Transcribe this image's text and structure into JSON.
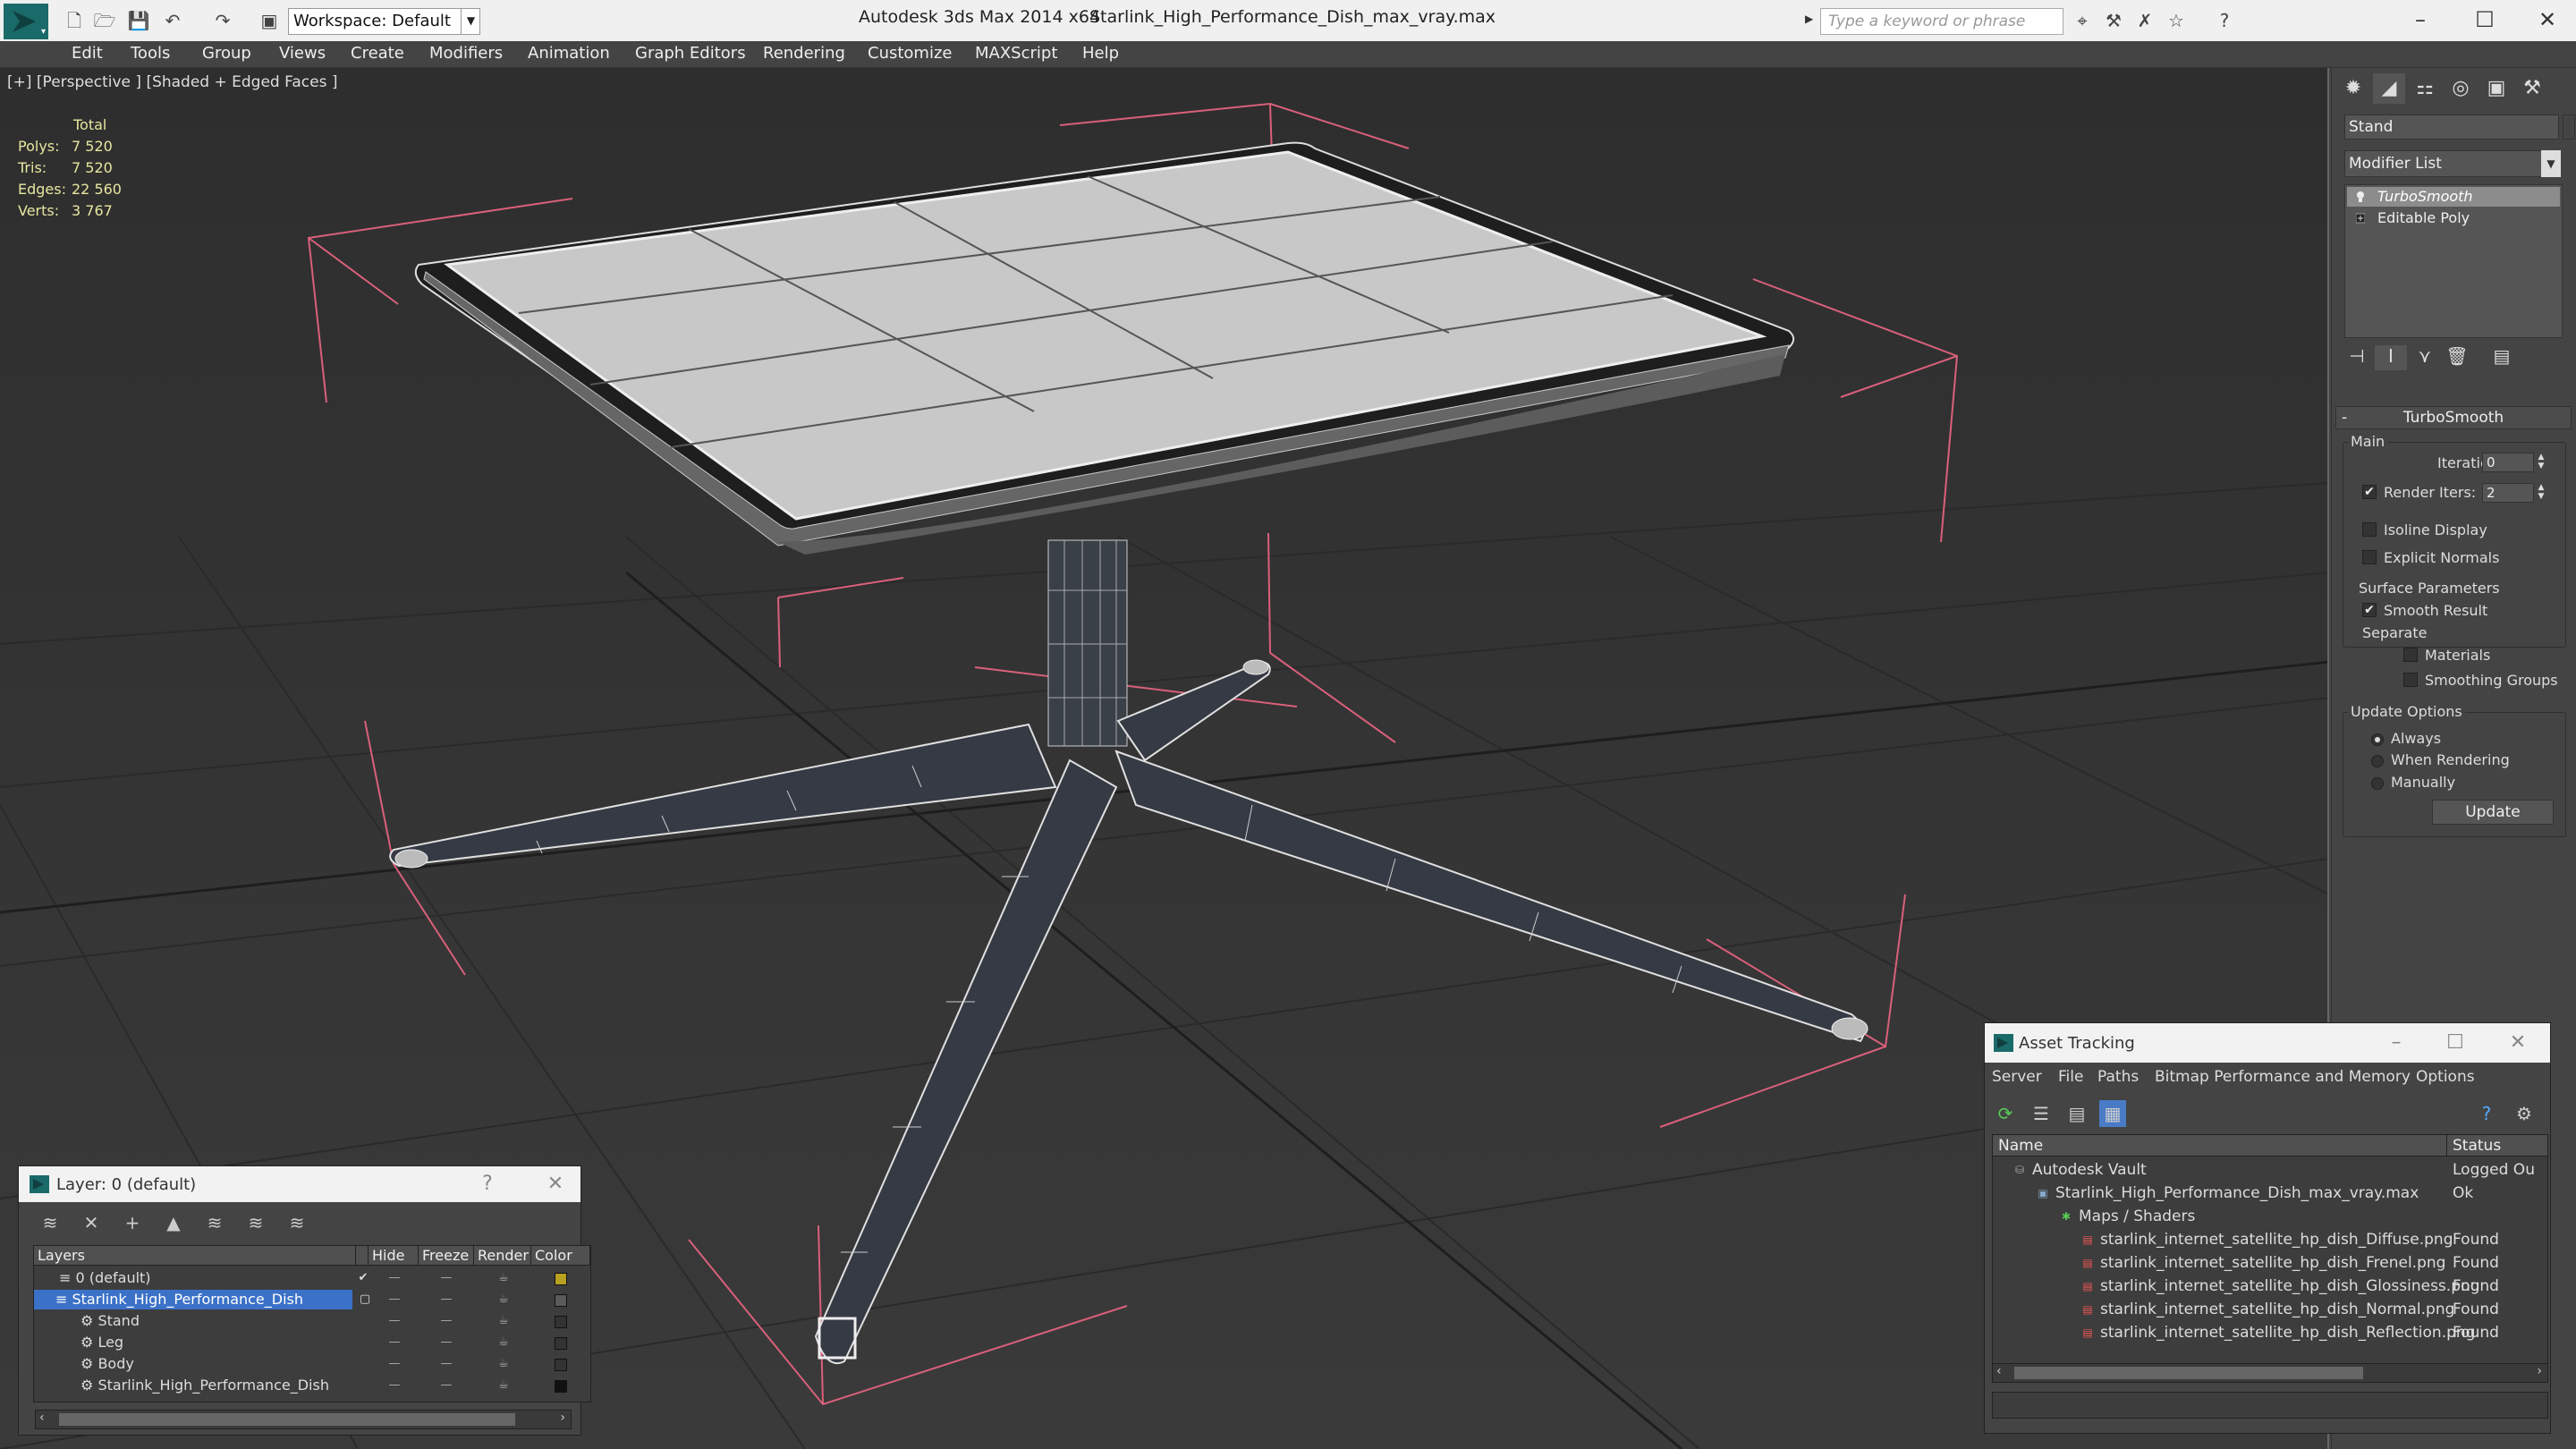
{
  "titlebar": {
    "workspace": "Workspace: Default",
    "app_title": "Autodesk 3ds Max  2014 x64",
    "file_title": "Starlink_High_Performance_Dish_max_vray.max",
    "search_placeholder": "Type a keyword or phrase"
  },
  "menu": [
    "Edit",
    "Tools",
    "Group",
    "Views",
    "Create",
    "Modifiers",
    "Animation",
    "Graph Editors",
    "Rendering",
    "Customize",
    "MAXScript",
    "Help"
  ],
  "viewport": {
    "label": "[+] [Perspective ] [Shaded + Edged Faces ]",
    "stats": {
      "header": "Total",
      "polys_label": "Polys:",
      "polys": "7 520",
      "tris_label": "Tris:",
      "tris": "7 520",
      "edges_label": "Edges:",
      "edges": "22 560",
      "verts_label": "Verts:",
      "verts": "3 767"
    }
  },
  "command_panel": {
    "object_name": "Stand",
    "modifier_list": "Modifier List",
    "stack": [
      "TurboSmooth",
      "Editable Poly"
    ],
    "rollout": "TurboSmooth",
    "main_group": "Main",
    "iterations_label": "Iterations:",
    "iterations": "0",
    "render_iters_label": "Render Iters:",
    "render_iters": "2",
    "isoline": "Isoline Display",
    "explicit_normals": "Explicit Normals",
    "surface_group": "Surface Parameters",
    "smooth_result": "Smooth Result",
    "separate": "Separate",
    "materials": "Materials",
    "smoothing_groups": "Smoothing Groups",
    "update_group": "Update Options",
    "always": "Always",
    "when_rendering": "When Rendering",
    "manually": "Manually",
    "update_button": "Update",
    "colors": {
      "accent": "#3b71c7"
    }
  },
  "layer_window": {
    "title": "Layer: 0 (default)",
    "columns": [
      "Layers",
      "Hide",
      "Freeze",
      "Render",
      "Color"
    ],
    "rows": [
      {
        "name": "0 (default)",
        "color": "#b8a020"
      },
      {
        "name": "Starlink_High_Performance_Dish",
        "color": "#5a5a5a"
      },
      {
        "name": "Stand",
        "color": "#333333"
      },
      {
        "name": "Leg",
        "color": "#333333"
      },
      {
        "name": "Body",
        "color": "#333333"
      },
      {
        "name": "Starlink_High_Performance_Dish",
        "color": "#111111"
      }
    ]
  },
  "asset_window": {
    "title": "Asset Tracking",
    "menu": [
      "Server",
      "File",
      "Paths",
      "Bitmap Performance and Memory",
      "Options"
    ],
    "columns": [
      "Name",
      "Status"
    ],
    "rows": [
      {
        "name": "Autodesk Vault",
        "status": "Logged Ou"
      },
      {
        "name": "Starlink_High_Performance_Dish_max_vray.max",
        "status": "Ok"
      },
      {
        "name": "Maps / Shaders",
        "status": ""
      },
      {
        "name": "starlink_internet_satellite_hp_dish_Diffuse.png",
        "status": "Found"
      },
      {
        "name": "starlink_internet_satellite_hp_dish_Frenel.png",
        "status": "Found"
      },
      {
        "name": "starlink_internet_satellite_hp_dish_Glossiness.png",
        "status": "Found"
      },
      {
        "name": "starlink_internet_satellite_hp_dish_Normal.png",
        "status": "Found"
      },
      {
        "name": "starlink_internet_satellite_hp_dish_Reflection.png",
        "status": "Found"
      }
    ]
  }
}
